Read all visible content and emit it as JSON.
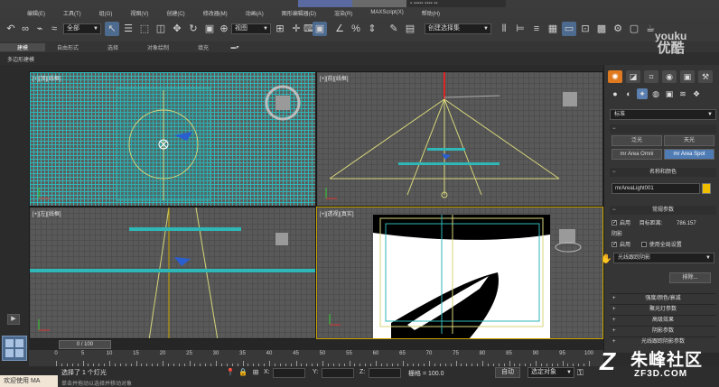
{
  "titlebar": {
    "doc_tab": "▪ ▪▪▪▪▪ ▪▪▪▪ ▪▪"
  },
  "menubar": {
    "items": [
      "编辑(E)",
      "工具(T)",
      "组(G)",
      "视图(V)",
      "创建(C)",
      "修改器(M)",
      "动画(A)",
      "图形编辑器(D)",
      "渲染(R)",
      "MAXScript(X)",
      "帮助(H)"
    ]
  },
  "toolbar": {
    "filter_select": "全部",
    "refcoord_select": "视图",
    "named_selection": "创建选择集"
  },
  "ribbon": {
    "tabs": [
      "建模",
      "自由形式",
      "选择",
      "对象绘制",
      "填充"
    ],
    "sub_label": "多边形建模"
  },
  "viewports": {
    "top": "[+][顶][线框]",
    "front": "[+][前][线框]",
    "left": "[+][左][线框]",
    "perspective": "[+][透视][真实]"
  },
  "command_panel": {
    "category_dropdown": "标准",
    "object_type_buttons": [
      "泛光",
      "天光",
      "mr Area Omni",
      "mr Area Spot"
    ],
    "name_color_title": "名称和颜色",
    "object_name": "mrAreaLight001",
    "color": "#f0c000",
    "general_params_title": "常规参数",
    "light_on_label": "启用",
    "target_distance_label": "目标距离:",
    "target_distance_value": "786.157",
    "shadows_title": "阴影",
    "shadow_on_label": "启用",
    "global_settings_label": "使用全局设置",
    "shadow_type": "光线跟踪阴影",
    "exclude_button": "排除...",
    "rollouts": [
      "强度/颜色/衰减",
      "聚光灯参数",
      "高级效果",
      "阴影参数",
      "光线跟踪阴影参数"
    ]
  },
  "timeline": {
    "slider_label": "0 / 100",
    "ticks": [
      "0",
      "5",
      "10",
      "15",
      "20",
      "25",
      "30",
      "35",
      "40",
      "45",
      "50",
      "55",
      "60",
      "65",
      "70",
      "75",
      "80",
      "85",
      "90",
      "95",
      "100"
    ]
  },
  "statusbar": {
    "welcome": "欢迎使用 MA",
    "status_primary": "选择了 1 个灯光",
    "status_secondary": "单击并拖动以选择并移动对象",
    "x_label": "X:",
    "y_label": "Y:",
    "z_label": "Z:",
    "grid_label": "栅格 = 100.0",
    "auto_key": "自动",
    "selection_filter": "选定对象"
  },
  "watermarks": {
    "youku_line1": "youku",
    "youku_line2": "优酷",
    "site_name": "朱峰社区",
    "site_url": "ZF3D.COM"
  }
}
